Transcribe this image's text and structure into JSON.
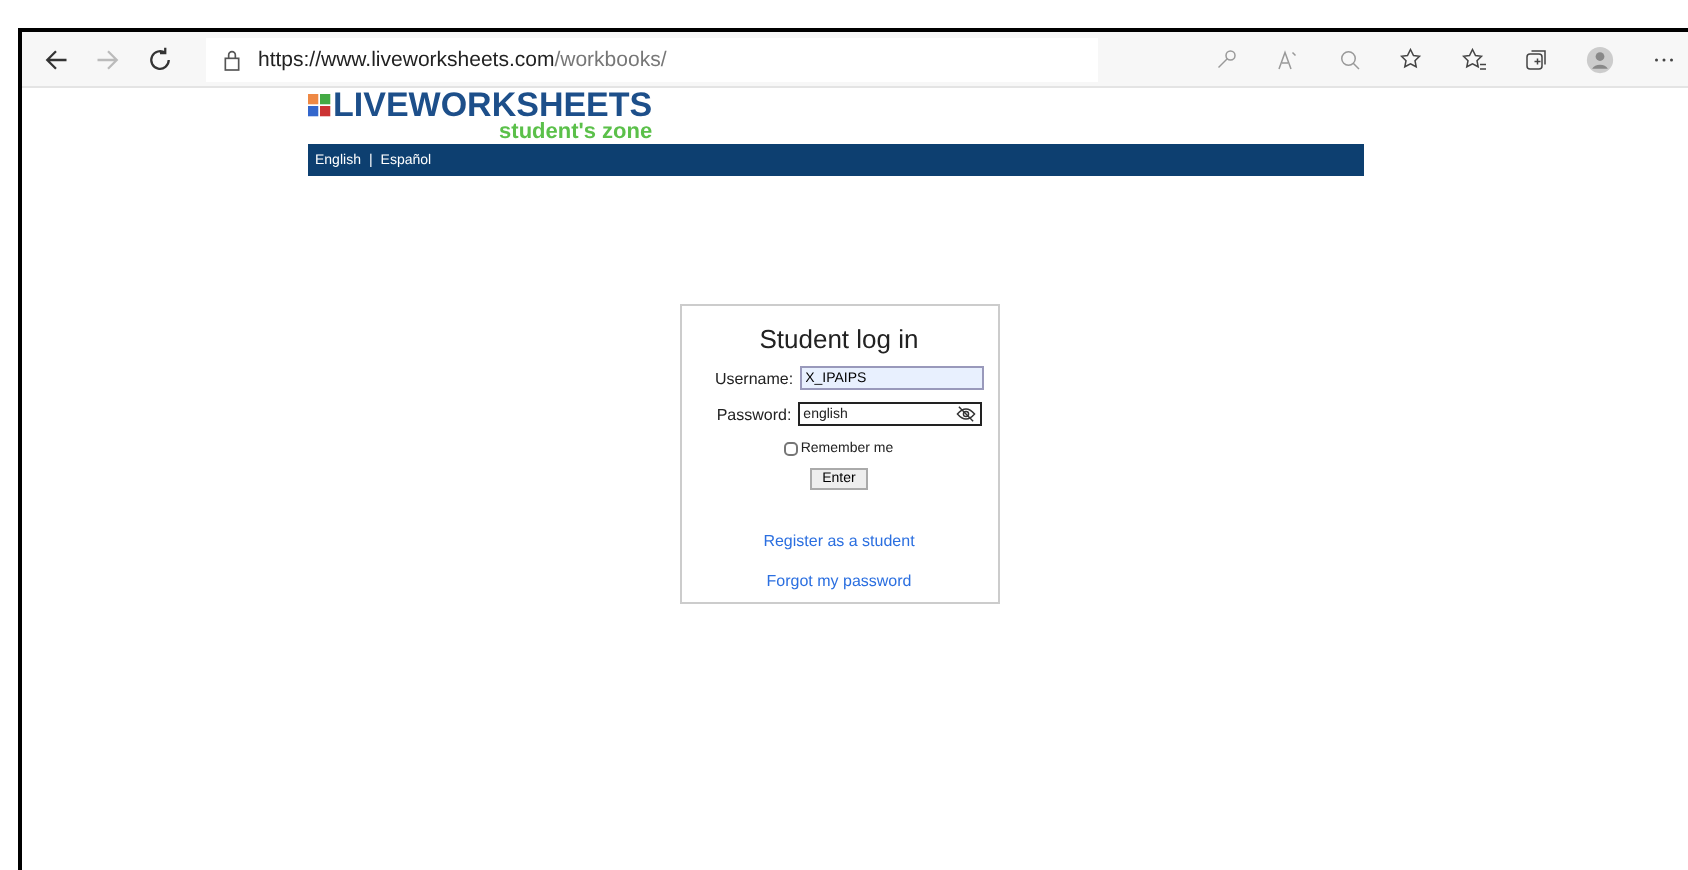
{
  "browser": {
    "url_host": "https://www.liveworksheets.com",
    "url_path": "/workbooks/"
  },
  "site": {
    "logo_text": "LIVEWORKSHEETS",
    "tagline": "student's zone",
    "languages": [
      {
        "label": "English"
      },
      {
        "label": "Español"
      }
    ],
    "separator": "|"
  },
  "login": {
    "title": "Student log in",
    "username": {
      "label": "Username:",
      "value": "X_IPAIPS",
      "autofilled": true
    },
    "password": {
      "label": "Password:",
      "value": "english",
      "focused": true
    },
    "remember": {
      "label": "Remember me",
      "checked": false
    },
    "submit": "Enter",
    "links": [
      "Register as a student",
      "Forgot my password"
    ]
  }
}
